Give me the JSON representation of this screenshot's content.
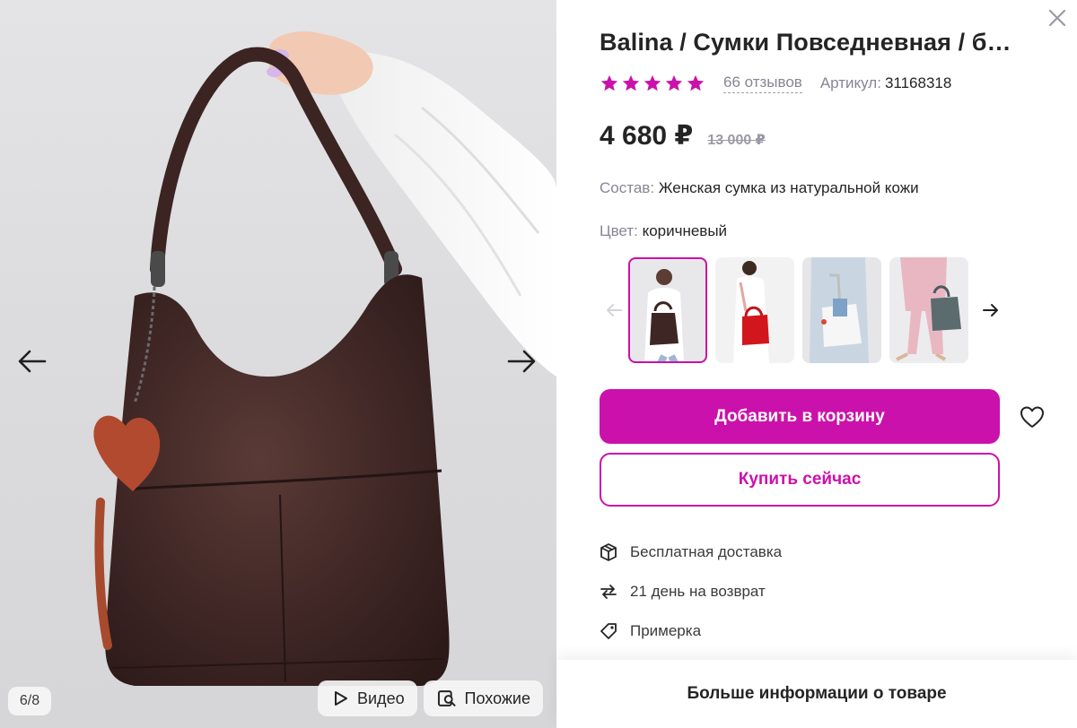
{
  "gallery": {
    "counter": "6/8",
    "video_label": "Видео",
    "similar_label": "Похожие"
  },
  "product": {
    "title": "Balina / Сумки Повседневная / б…",
    "rating": 5,
    "reviews": "66 отзывов",
    "article_label": "Артикул:",
    "article_value": "31168318",
    "price": "4 680 ₽",
    "old_price": "13 000 ₽",
    "composition_label": "Состав:",
    "composition_value": "Женская сумка из натуральной кожи",
    "color_label": "Цвет:",
    "color_value": "коричневый"
  },
  "thumbnails": [
    {
      "name": "brown-bag-model",
      "active": true
    },
    {
      "name": "red-bag-model",
      "active": false
    },
    {
      "name": "white-bag-model",
      "active": false
    },
    {
      "name": "grey-bag-model",
      "active": false
    }
  ],
  "actions": {
    "add_to_cart": "Добавить в корзину",
    "buy_now": "Купить сейчас"
  },
  "features": [
    {
      "icon": "box-icon",
      "label": "Бесплатная доставка"
    },
    {
      "icon": "return-arrows-icon",
      "label": "21 день на возврат"
    },
    {
      "icon": "tag-icon",
      "label": "Примерка"
    }
  ],
  "more_info": "Больше информации о товаре",
  "colors": {
    "accent": "#cb11ab",
    "star": "#cb11ab",
    "text": "#242424",
    "muted": "#868695"
  }
}
